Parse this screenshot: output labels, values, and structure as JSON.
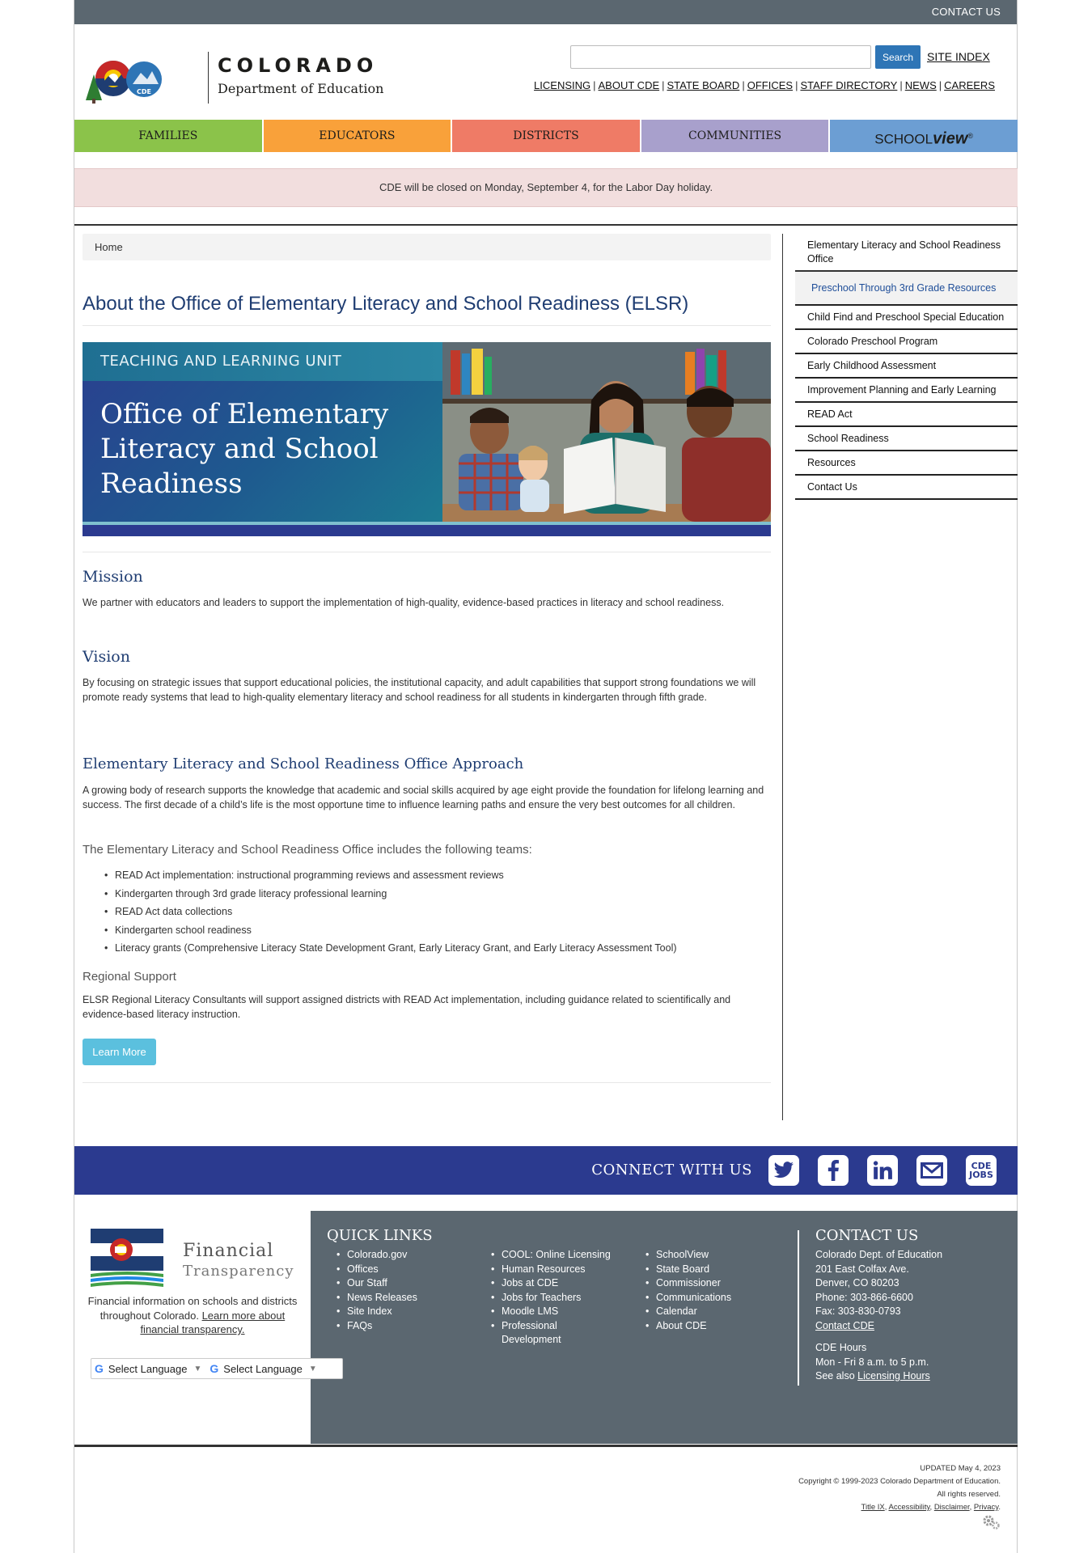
{
  "topbar": {
    "contact_label": "CONTACT US"
  },
  "header": {
    "state_name": "COLORADO",
    "dept_name": "Department of Education",
    "logo_label": "CDE",
    "search_placeholder": "",
    "search_button": "Search",
    "site_index": "SITE INDEX",
    "utility_links": [
      "LICENSING",
      "ABOUT CDE",
      "STATE BOARD",
      "OFFICES",
      "STAFF DIRECTORY",
      "NEWS",
      "CAREERS"
    ]
  },
  "main_nav": {
    "tabs": [
      "FAMILIES",
      "EDUCATORS",
      "DISTRICTS",
      "COMMUNITIES"
    ],
    "schoolview_prefix": "SCHOOL",
    "schoolview_word": "view",
    "schoolview_mark": "®"
  },
  "alert": {
    "text": "CDE will be closed on Monday, September 4, for the Labor Day holiday."
  },
  "breadcrumb": {
    "home": "Home"
  },
  "page_title": "About the Office of Elementary Literacy and School Readiness (ELSR)",
  "banner": {
    "unit": "TEACHING AND LEARNING UNIT",
    "title": "Office of Elementary Literacy and School Readiness"
  },
  "mission": {
    "heading": "Mission",
    "text": "We partner with educators and leaders to support the implementation of high-quality, evidence-based practices in literacy and school readiness."
  },
  "vision": {
    "heading": "Vision",
    "text": "By focusing on strategic issues that support educational policies, the institutional capacity, and adult capabilities that support strong foundations we will promote ready systems that lead to high-quality elementary literacy and school readiness for all students in kindergarten through fifth grade."
  },
  "approach": {
    "heading": "Elementary Literacy and School Readiness Office Approach",
    "text": "A growing body of research supports the knowledge that academic and social skills acquired by age eight provide the foundation for lifelong learning and success. The first decade of a child’s life is the most opportune time to influence learning paths and ensure the very best outcomes for all children.",
    "teams_heading": "The Elementary Literacy and School Readiness Office includes the following teams:",
    "teams": [
      "READ Act implementation: instructional programming reviews and assessment reviews",
      "Kindergarten through 3rd grade literacy professional learning",
      "READ Act data collections",
      "Kindergarten school readiness",
      "Literacy grants (Comprehensive Literacy State Development Grant, Early Literacy Grant, and Early Literacy Assessment Tool)"
    ],
    "regional_heading": "Regional Support",
    "regional_text": "ELSR Regional Literacy Consultants will support assigned districts with READ Act implementation, including guidance related to scientifically and evidence-based literacy instruction.",
    "learn_more": "Learn More"
  },
  "sidebar": {
    "title": "Elementary Literacy and School Readiness Office",
    "active": "Preschool Through 3rd Grade Resources",
    "items": [
      "Child Find and Preschool Special Education",
      "Colorado Preschool Program",
      "Early Childhood Assessment",
      "Improvement Planning and Early Learning",
      "READ Act",
      "School Readiness",
      "Resources",
      "Contact Us"
    ]
  },
  "connect": {
    "label": "CONNECT WITH US",
    "jobs_line1": "CDE",
    "jobs_line2": "JOBS"
  },
  "footer": {
    "fin_title1": "Financial",
    "fin_title2": "Transparency",
    "fin_text": "Financial information on schools and districts throughout Colorado.",
    "fin_link": "Learn more about financial transparency.",
    "lang_label": "Select Language",
    "quick_links_title": "QUICK LINKS",
    "quick_links": [
      [
        "Colorado.gov",
        "Offices",
        "Our Staff",
        "News Releases",
        "Site Index",
        "FAQs"
      ],
      [
        "COOL: Online Licensing",
        "Human Resources",
        "Jobs at CDE",
        "Jobs for Teachers",
        "Moodle LMS",
        "Professional Development"
      ],
      [
        "SchoolView",
        "State Board",
        "Commissioner",
        "Communications",
        "Calendar",
        "About CDE"
      ]
    ],
    "contact_title": "CONTACT US",
    "contact_lines": [
      "Colorado Dept. of Education",
      "201 East Colfax Ave.",
      "Denver, CO 80203",
      "Phone: 303-866-6600",
      "Fax: 303-830-0793"
    ],
    "contact_link": "Contact CDE",
    "hours_title": "CDE Hours",
    "hours": "Mon - Fri 8 a.m. to 5 p.m.",
    "see_also": "See also",
    "licensing_hours": "Licensing Hours"
  },
  "legal": {
    "updated": "UPDATED May 4, 2023",
    "copyright": "Copyright © 1999-2023 Colorado Department of Education.",
    "rights": "All rights reserved.",
    "links": [
      "Title IX",
      "Accessibility",
      "Disclaimer",
      "Privacy"
    ]
  }
}
